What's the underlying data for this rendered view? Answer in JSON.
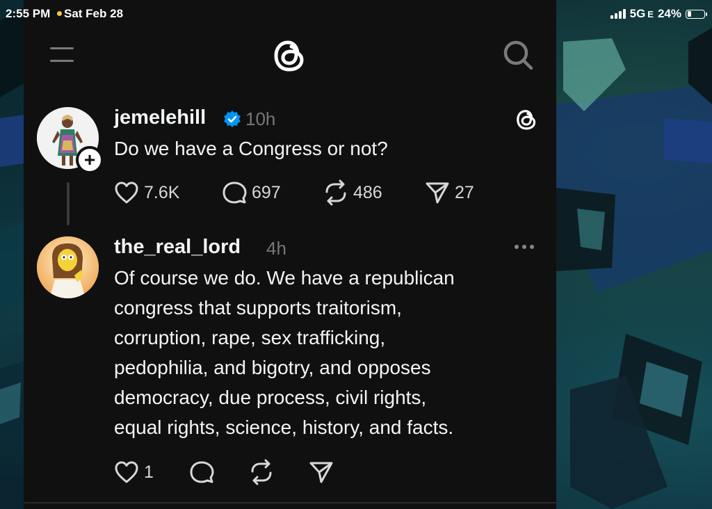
{
  "status_bar": {
    "time": "2:55 PM",
    "date": "Sat Feb 28",
    "network": "5G",
    "network_sub": "E",
    "battery": "24%",
    "battery_level": 0.24
  },
  "header": {
    "menu_icon": "hamburger-menu-icon",
    "logo_icon": "threads-logo",
    "search_icon": "search-icon"
  },
  "posts": [
    {
      "username": "jemelehill",
      "verified": true,
      "time": "10h",
      "text_lines": [
        "Do we have a Congress or not?"
      ],
      "actions": {
        "likes": "7.6K",
        "comments": "697",
        "reposts": "486",
        "shares": "27"
      }
    },
    {
      "username": "the_real_lord",
      "verified": false,
      "time": "4h",
      "text_lines": [
        "Of course we do. We have a republican",
        "congress that supports traitorism,",
        "corruption, rape, sex trafficking,",
        "pedophilia, and bigotry, and opposes",
        "democracy, due process, civil rights,",
        "equal rights, science, history, and facts."
      ],
      "actions": {
        "likes": "1",
        "comments": "",
        "reposts": "",
        "shares": ""
      }
    }
  ],
  "colors": {
    "panel_bg": "#101010",
    "text_primary": "#f3f5f7",
    "text_muted": "#777777",
    "verified_blue": "#0095f6"
  }
}
